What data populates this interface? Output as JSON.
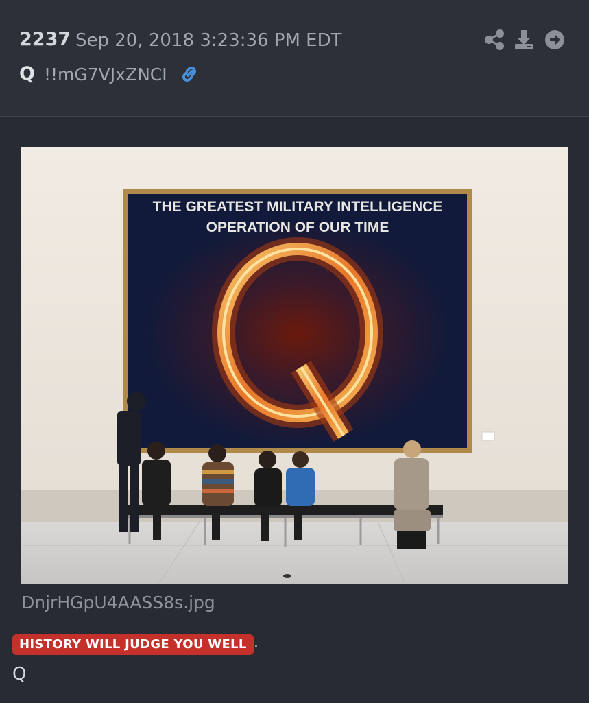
{
  "post": {
    "number": "2237",
    "date": "Sep 20, 2018 3:23:36 PM EDT",
    "author": "Q",
    "tripcode": "!!mG7VJxZNCI"
  },
  "icons": {
    "link": "link-icon",
    "share": "share-icon",
    "download": "download-icon",
    "navigate": "arrow-right-circle-icon"
  },
  "image": {
    "filename": "DnjrHGpU4AASS8s.jpg",
    "painting_caption_line1": "THE GREATEST MILITARY INTELLIGENCE",
    "painting_caption_line2": "OPERATION OF OUR TIME",
    "painting_letter": "Q"
  },
  "message": {
    "highlight": "HISTORY WILL JUDGE YOU WELL",
    "trailing": ".",
    "signature": "Q"
  },
  "colors": {
    "background": "#272b33",
    "header_bg": "#2c3038",
    "highlight_bg": "#c4312b",
    "link_blue": "#4a90d9",
    "icon_gray": "#8b9099"
  }
}
